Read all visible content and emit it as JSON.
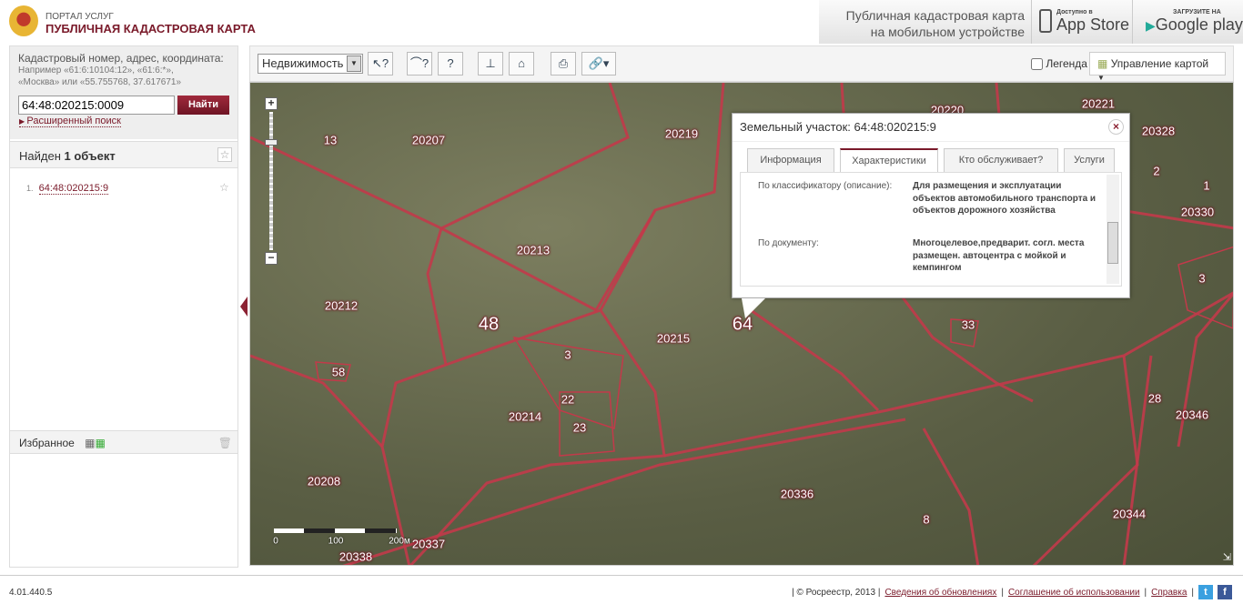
{
  "header": {
    "portal": "ПОРТАЛ УСЛУГ",
    "title": "ПУБЛИЧНАЯ КАДАСТРОВАЯ КАРТА",
    "mobile_line1": "Публичная кадастровая карта",
    "mobile_line2": "на мобильном устройстве",
    "appstore_small": "Доступно в",
    "appstore_big": "App Store",
    "gplay_small": "ЗАГРУЗИТЕ НА",
    "gplay_big": "Google play"
  },
  "search": {
    "label": "Кадастровый номер, адрес, координата:",
    "hint1": "Например «61:6:10104:12», «61:6:*»,",
    "hint2": "«Москва» или «55.755768, 37.617671»",
    "value": "64:48:020215:0009",
    "button": "Найти",
    "advanced": "Расширенный поиск"
  },
  "results": {
    "found_prefix": "Найден ",
    "found_count": "1 объект",
    "items": [
      {
        "index": "1.",
        "label": "64:48:020215:9"
      }
    ]
  },
  "favorites": {
    "label": "Избранное"
  },
  "toolbar": {
    "layer_select": "Недвижимость",
    "legend": "Легенда",
    "map_control": "Управление картой"
  },
  "map": {
    "labels": [
      "13",
      "20207",
      "20219",
      "20220",
      "20221",
      "20328",
      "2",
      "1",
      "20330",
      "3",
      "33",
      "20213",
      "20212",
      "48",
      "3",
      "20215",
      "64",
      "58",
      "22",
      "23",
      "20214",
      "20346",
      "28",
      "20208",
      "20336",
      "8",
      "20344",
      "20337",
      "20338"
    ],
    "scale": {
      "zero": "0",
      "mid": "100",
      "end": "200м"
    }
  },
  "popup": {
    "title": "Земельный участок: 64:48:020215:9",
    "tabs": [
      "Информация",
      "Характеристики",
      "Кто обслуживает?",
      "Услуги"
    ],
    "active_tab": "Характеристики",
    "rows": [
      {
        "key": "По классификатору (описание):",
        "value": "Для размещения и эксплуатации объектов автомобильного транспорта и объектов дорожного хозяйства"
      },
      {
        "key": "По документу:",
        "value": "Многоцелевое,предварит. согл. места размещен. автоцентра с мойкой и кемпингом"
      }
    ]
  },
  "footer": {
    "version": "4.01.440.5",
    "copyright": "| © Росреестр, 2013 |",
    "link1": "Сведения об обновлениях",
    "link2": "Соглашение об использовании",
    "link3": "Справка"
  }
}
